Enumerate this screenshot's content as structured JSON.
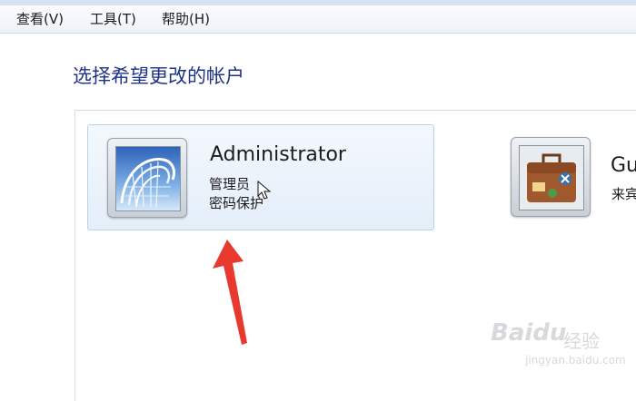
{
  "menubar": {
    "items": [
      "查看(V)",
      "工具(T)",
      "帮助(H)"
    ]
  },
  "heading": "选择希望更改的帐户",
  "accounts": [
    {
      "name": "Administrator",
      "role": "管理员",
      "status": "密码保护",
      "picture": "roller-coaster",
      "selected": true
    },
    {
      "name": "Gu",
      "role": "来宾",
      "picture": "suitcase",
      "selected": false
    }
  ],
  "watermark": {
    "brand": "Baidu",
    "cn": "经验",
    "url": "jingyan.baidu.com"
  },
  "colors": {
    "heading": "#1e3287",
    "selected_bg": "#e4eef9",
    "selected_border": "#b8d2ea",
    "arrow": "#e8392f"
  }
}
